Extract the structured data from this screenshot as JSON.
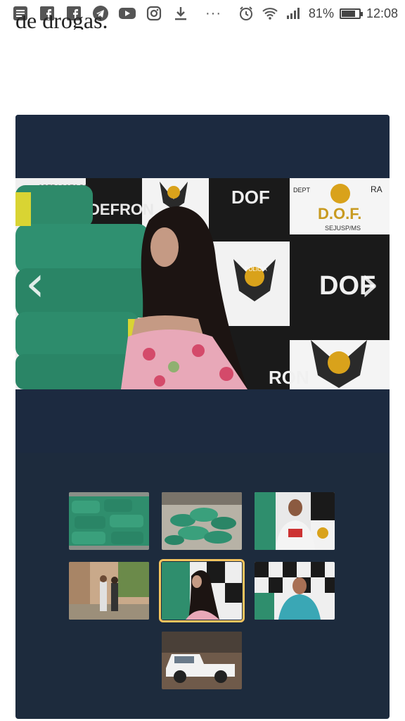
{
  "status_bar": {
    "battery_text": "81%",
    "battery_level": 0.81,
    "time": "12:08",
    "overflow": "···",
    "icons": [
      "notes-icon",
      "facebook-icon",
      "facebook-icon",
      "telegram-icon",
      "youtube-icon",
      "instagram-icon",
      "download-icon",
      "alarm-icon",
      "wifi-icon",
      "signal-icon",
      "battery-icon"
    ]
  },
  "article": {
    "clipped_text": "de drogas."
  },
  "gallery": {
    "prev_label": "‹",
    "next_label": "›",
    "slide_signs": {
      "defron": "DEFRON",
      "dof_a": "DOF",
      "dof_b": "D.O.F.",
      "sejusp": "SEJUSP/MS",
      "policia": "POLICIA",
      "dof_c": "DOF",
      "fron": "RON",
      "depto": "DEPT",
      "ra": "RA",
      "top_left": "OPERACOES DE"
    },
    "thumbnails": [
      {
        "name": "thumb-drug-bales-stack"
      },
      {
        "name": "thumb-drug-bales-floor"
      },
      {
        "name": "thumb-suspect-man-1"
      },
      {
        "name": "thumb-arrest-walkway"
      },
      {
        "name": "thumb-suspect-woman",
        "active": true
      },
      {
        "name": "thumb-suspect-man-2"
      },
      {
        "name": "thumb-white-pickup"
      }
    ],
    "colors": {
      "background": "#1d2b3d",
      "active_border": "#f6c45e",
      "bales": "#2e8a6a"
    }
  }
}
